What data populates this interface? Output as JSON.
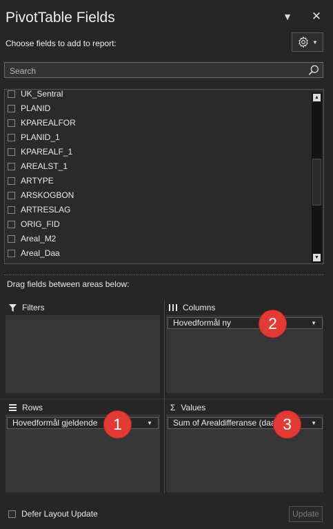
{
  "header": {
    "title": "PivotTable Fields",
    "dropdown_icon": "caret-down-icon",
    "close_icon": "close-icon",
    "choose_label": "Choose fields to add to report:"
  },
  "search": {
    "placeholder": "Search",
    "icon": "search-icon"
  },
  "fields": [
    {
      "label": "UK_Sentral",
      "checked": false
    },
    {
      "label": "PLANID",
      "checked": false
    },
    {
      "label": "KPAREALFOR",
      "checked": false
    },
    {
      "label": "PLANID_1",
      "checked": false
    },
    {
      "label": "KPAREALF_1",
      "checked": false
    },
    {
      "label": "AREALST_1",
      "checked": false
    },
    {
      "label": "ARTYPE",
      "checked": false
    },
    {
      "label": "ARSKOGBON",
      "checked": false
    },
    {
      "label": "ARTRESLAG",
      "checked": false
    },
    {
      "label": "ORIG_FID",
      "checked": false
    },
    {
      "label": "Areal_M2",
      "checked": false
    },
    {
      "label": "Areal_Daa",
      "checked": false
    }
  ],
  "drag_label": "Drag fields between areas below:",
  "areas": {
    "filters": {
      "title": "Filters",
      "icon": "filter-icon"
    },
    "columns": {
      "title": "Columns",
      "icon": "columns-icon",
      "item": "Hovedformål ny",
      "badge": "2"
    },
    "rows": {
      "title": "Rows",
      "icon": "rows-icon",
      "item": "Hovedformål gjeldende",
      "badge": "1"
    },
    "values": {
      "title": "Values",
      "icon": "sigma-icon",
      "glyph": "Σ",
      "item": "Sum of Arealdifferanse (daa)",
      "badge": "3"
    }
  },
  "footer": {
    "defer_label": "Defer Layout Update",
    "update_label": "Update"
  },
  "colors": {
    "background": "#262626",
    "area_box": "#363636",
    "badge": "#e23b36"
  }
}
